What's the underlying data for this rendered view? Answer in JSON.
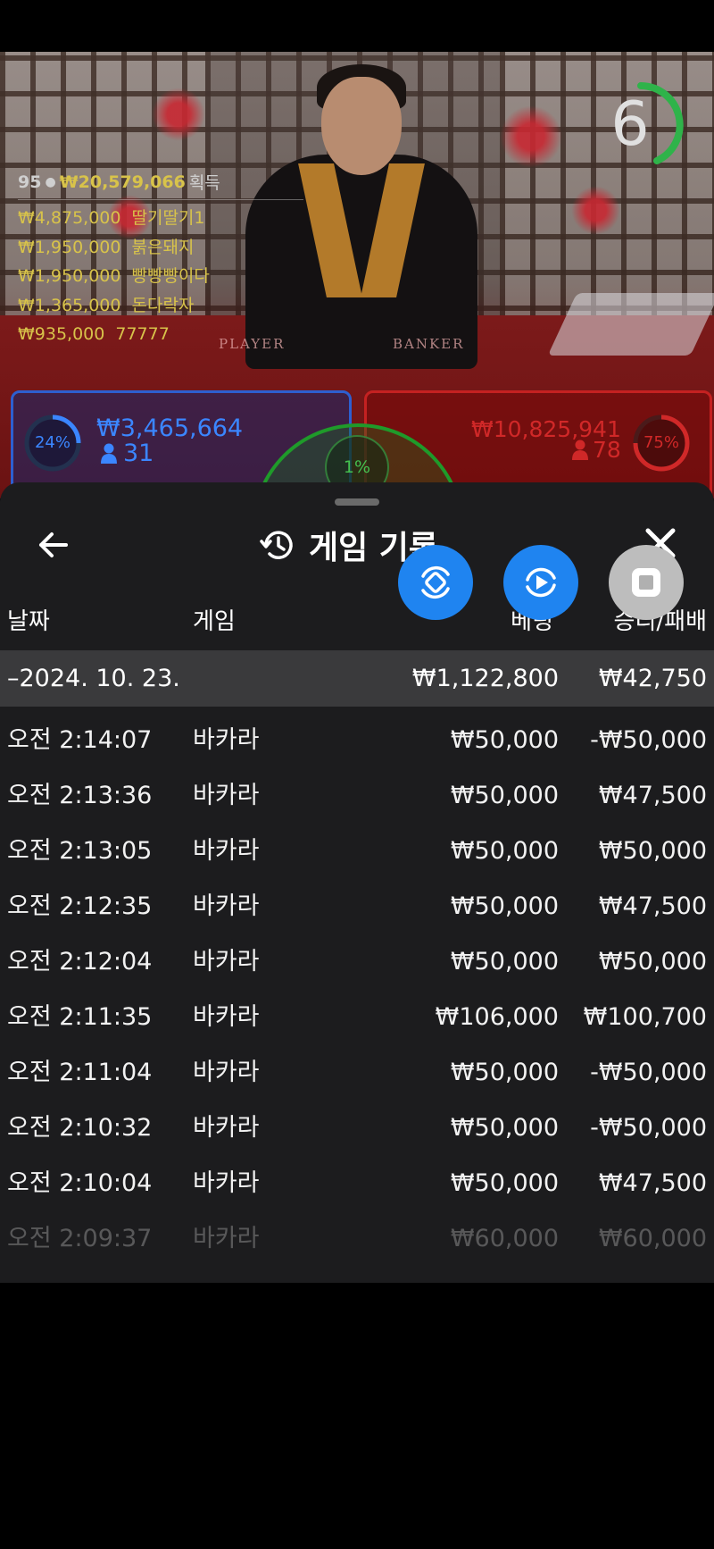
{
  "winners": {
    "count": "95",
    "total": "₩20,579,066",
    "total_label": "획득",
    "rows": [
      {
        "amount": "₩4,875,000",
        "name": "딸기딸기1"
      },
      {
        "amount": "₩1,950,000",
        "name": "붉은돼지"
      },
      {
        "amount": "₩1,950,000",
        "name": "빵빵빵이다"
      },
      {
        "amount": "₩1,365,000",
        "name": "돈다락자"
      },
      {
        "amount": "₩935,000",
        "name": "77777"
      }
    ]
  },
  "timer": {
    "value": "6",
    "color": "#2fb34a"
  },
  "table_labels": {
    "player": "PLAYER",
    "banker": "BANKER"
  },
  "bets": {
    "player": {
      "percent": "24%",
      "amount": "₩3,465,664",
      "players": "31",
      "color": "#3b86ff"
    },
    "tie": {
      "percent": "1%",
      "color": "#2fb34a"
    },
    "banker": {
      "percent": "75%",
      "amount": "₩10,825,941",
      "players": "78",
      "color": "#d02828"
    }
  },
  "history": {
    "title": "게임 기록",
    "columns": {
      "date": "날짜",
      "game": "게임",
      "bet": "베팅",
      "result": "승리/패배"
    },
    "date_group": {
      "date": "–2024. 10. 23.",
      "bet_total": "₩1,122,800",
      "result_total": "₩42,750"
    },
    "rows": [
      {
        "time": "오전 2:14:07",
        "game": "바카라",
        "bet": "₩50,000",
        "result": "-₩50,000"
      },
      {
        "time": "오전 2:13:36",
        "game": "바카라",
        "bet": "₩50,000",
        "result": "₩47,500"
      },
      {
        "time": "오전 2:13:05",
        "game": "바카라",
        "bet": "₩50,000",
        "result": "₩50,000"
      },
      {
        "time": "오전 2:12:35",
        "game": "바카라",
        "bet": "₩50,000",
        "result": "₩47,500"
      },
      {
        "time": "오전 2:12:04",
        "game": "바카라",
        "bet": "₩50,000",
        "result": "₩50,000"
      },
      {
        "time": "오전 2:11:35",
        "game": "바카라",
        "bet": "₩106,000",
        "result": "₩100,700"
      },
      {
        "time": "오전 2:11:04",
        "game": "바카라",
        "bet": "₩50,000",
        "result": "-₩50,000"
      },
      {
        "time": "오전 2:10:32",
        "game": "바카라",
        "bet": "₩50,000",
        "result": "-₩50,000"
      },
      {
        "time": "오전 2:10:04",
        "game": "바카라",
        "bet": "₩50,000",
        "result": "₩47,500"
      },
      {
        "time": "오전 2:09:37",
        "game": "바카라",
        "bet": "₩60,000",
        "result": "₩60,000"
      }
    ]
  },
  "icons": {
    "back": "back-arrow-icon",
    "close": "close-icon",
    "history": "history-icon",
    "fab_rotate": "rotate-screen-icon",
    "fab_replay": "replay-icon",
    "fab_stop": "stop-icon"
  }
}
